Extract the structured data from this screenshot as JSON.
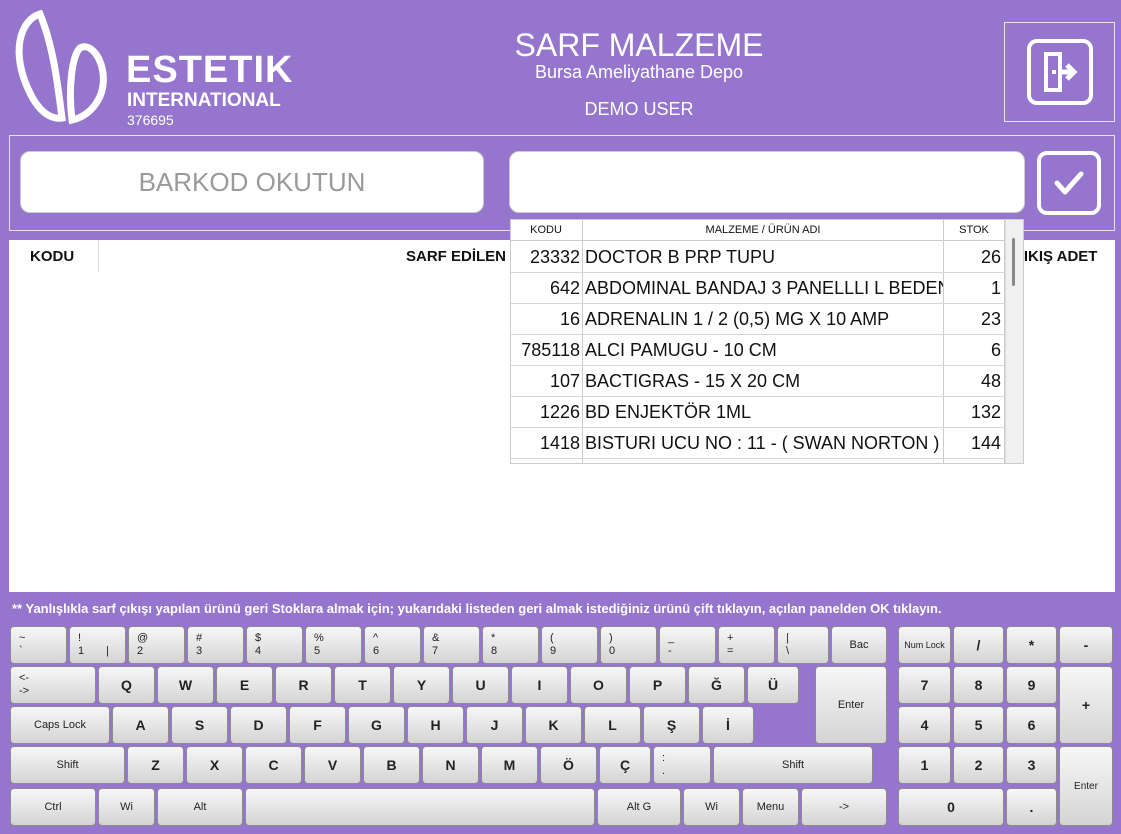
{
  "brand": {
    "name": "ESTETIK",
    "sub": "INTERNATIONAL",
    "code": "376695"
  },
  "header": {
    "title": "SARF MALZEME",
    "subtitle": "Bursa Ameliyathane Depo",
    "user": "DEMO USER"
  },
  "icons": {
    "exit": "exit-door-icon",
    "confirm": "checkmark-icon"
  },
  "scan": {
    "barcode_placeholder": "BARKOD OKUTUN",
    "search_value": ""
  },
  "main_table": {
    "columns": [
      "KODU",
      "SARF EDİLEN",
      "ÇIKIŞ ADET"
    ]
  },
  "dropdown": {
    "columns": [
      "KODU",
      "MALZEME / ÜRÜN ADI",
      "STOK"
    ],
    "rows": [
      {
        "code": "23332",
        "name": " DOCTOR B  PRP TUPU",
        "stock": "26"
      },
      {
        "code": "642",
        "name": "ABDOMINAL BANDAJ 3 PANELLLI L BEDEN",
        "stock": "1"
      },
      {
        "code": "16",
        "name": "ADRENALIN 1 / 2 (0,5) MG X 10 AMP",
        "stock": "23"
      },
      {
        "code": "785118",
        "name": "ALCI PAMUGU - 10 CM",
        "stock": "6"
      },
      {
        "code": "107",
        "name": "BACTIGRAS - 15 X 20 CM",
        "stock": "48"
      },
      {
        "code": "1226",
        "name": "BD ENJEKTÖR 1ML",
        "stock": "132"
      },
      {
        "code": "1418",
        "name": "BISTURI UCU NO : 11 - ( SWAN NORTON )",
        "stock": "144"
      }
    ]
  },
  "note": "** Yanlışlıkla sarf çıkışı yapılan ürünü geri Stoklara almak için; yukarıdaki listeden geri almak istediğiniz ürünü çift tıklayın, açılan panelden OK tıklayın.",
  "keyboard": {
    "num_row": [
      {
        "top": "~",
        "bot": "`"
      },
      {
        "top": "!",
        "bot": "1"
      },
      {
        "top": "@",
        "bot": "2"
      },
      {
        "top": "#",
        "bot": "3"
      },
      {
        "top": "$",
        "bot": "4"
      },
      {
        "top": "%",
        "bot": "5"
      },
      {
        "top": "^",
        "bot": "6"
      },
      {
        "top": "&",
        "bot": "7"
      },
      {
        "top": "*",
        "bot": "8"
      },
      {
        "top": "(",
        "bot": "9"
      },
      {
        "top": ")",
        "bot": "0"
      },
      {
        "top": "_",
        "bot": "-"
      },
      {
        "top": "+",
        "bot": "="
      },
      {
        "top": "|",
        "bot": "\\"
      }
    ],
    "pipe_mark": "|",
    "bac": "Bac",
    "tab": {
      "top": "<-",
      "bot": "->"
    },
    "row_q": [
      "Q",
      "W",
      "E",
      "R",
      "T",
      "Y",
      "U",
      "I",
      "O",
      "P",
      "Ğ",
      "Ü"
    ],
    "enter": "Enter",
    "caps": "Caps Lock",
    "row_a": [
      "A",
      "S",
      "D",
      "F",
      "G",
      "H",
      "J",
      "K",
      "L",
      "Ş",
      "İ"
    ],
    "shift": "Shift",
    "row_z": [
      "Z",
      "X",
      "C",
      "V",
      "B",
      "N",
      "M",
      "Ö",
      "Ç"
    ],
    "dot_key": {
      "top": ":",
      "bot": "."
    },
    "ctrl": "Ctrl",
    "win": "Wi",
    "alt": "Alt",
    "space": "",
    "altg": "Alt G",
    "menu": "Menu",
    "arrow": "->",
    "numpad": {
      "numlock": "Num Lock",
      "div": "/",
      "mul": "*",
      "sub": "-",
      "r1": [
        "7",
        "8",
        "9"
      ],
      "add": "+",
      "r2": [
        "4",
        "5",
        "6"
      ],
      "r3": [
        "1",
        "2",
        "3"
      ],
      "enter": "Enter",
      "zero": "0",
      "dot": "."
    }
  }
}
